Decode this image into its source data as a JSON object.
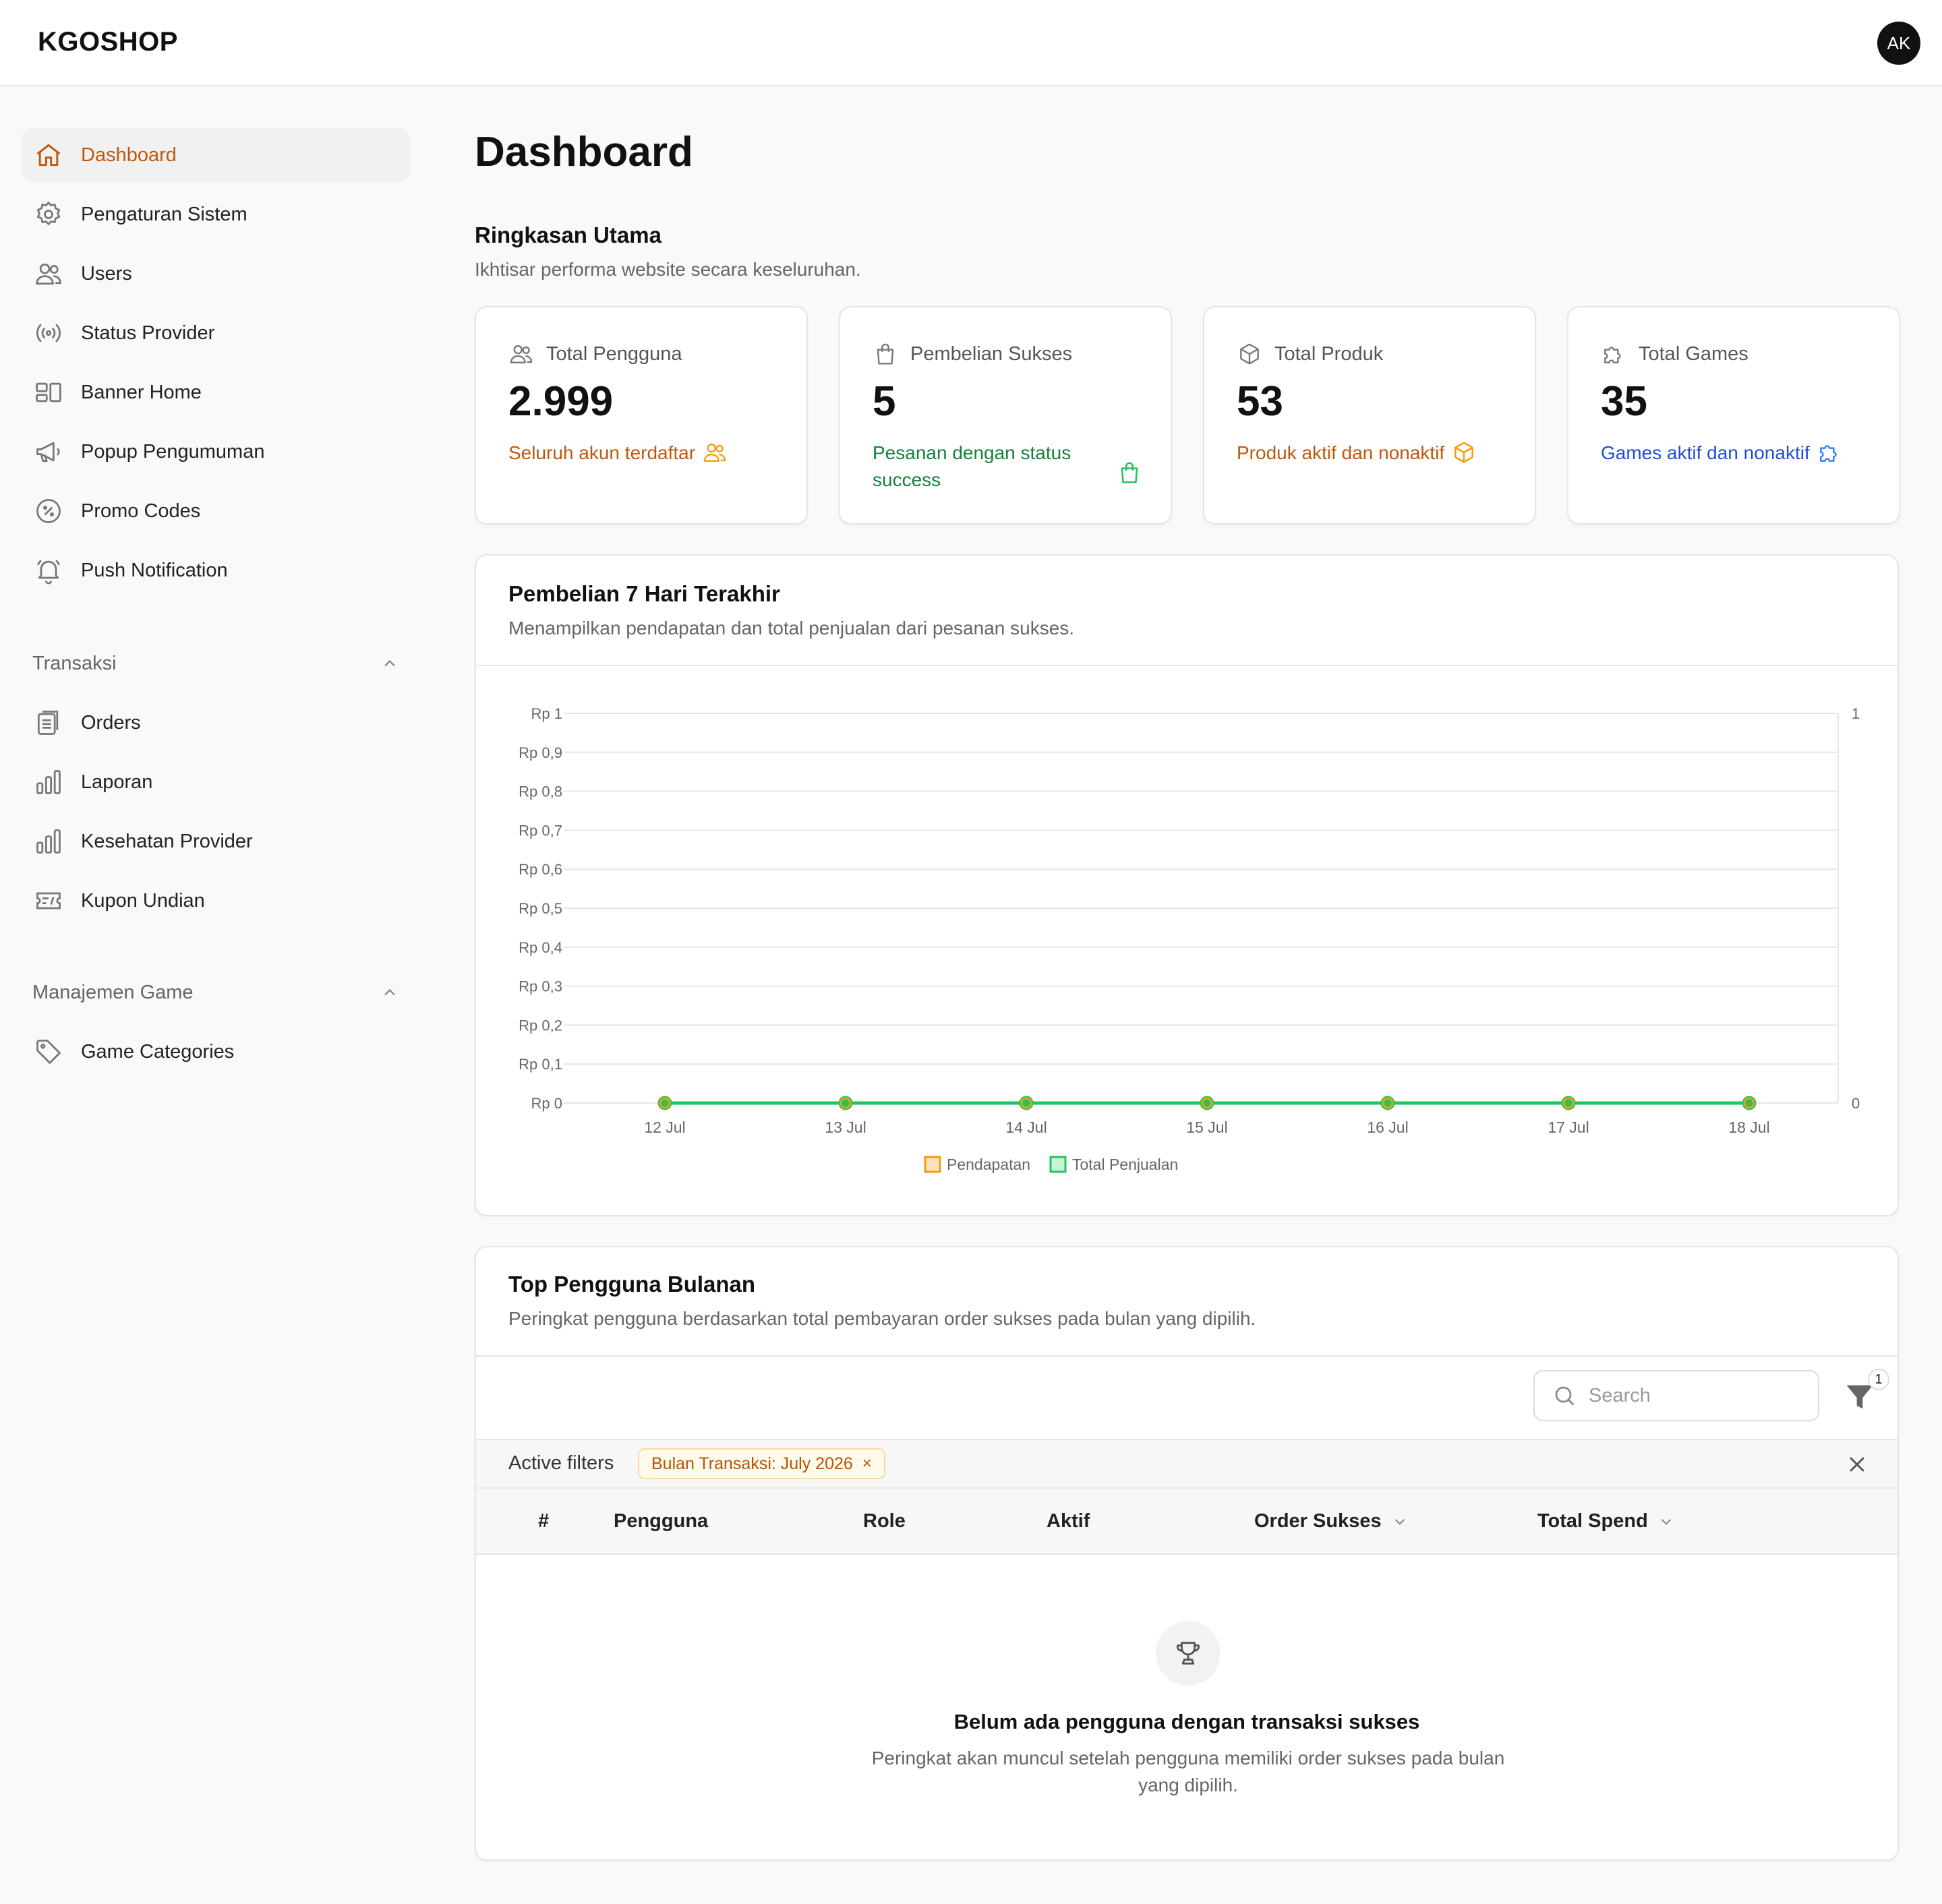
{
  "app": {
    "logo": "KGOSHOP",
    "avatar_initials": "AK"
  },
  "sidebar": {
    "items": [
      {
        "label": "Dashboard",
        "icon": "home-icon",
        "active": true
      },
      {
        "label": "Pengaturan Sistem",
        "icon": "gear-icon"
      },
      {
        "label": "Users",
        "icon": "users-icon"
      },
      {
        "label": "Status Provider",
        "icon": "broadcast-icon"
      },
      {
        "label": "Banner Home",
        "icon": "layout-icon"
      },
      {
        "label": "Popup Pengumuman",
        "icon": "megaphone-icon"
      },
      {
        "label": "Promo Codes",
        "icon": "percent-badge-icon"
      },
      {
        "label": "Push Notification",
        "icon": "bell-icon"
      }
    ],
    "sections": [
      {
        "title": "Transaksi",
        "items": [
          {
            "label": "Orders",
            "icon": "clipboard-list-icon"
          },
          {
            "label": "Laporan",
            "icon": "bar-chart-icon"
          },
          {
            "label": "Kesehatan Provider",
            "icon": "bar-chart-icon"
          },
          {
            "label": "Kupon Undian",
            "icon": "ticket-icon"
          }
        ]
      },
      {
        "title": "Manajemen Game",
        "items": [
          {
            "label": "Game Categories",
            "icon": "tag-icon"
          }
        ]
      }
    ]
  },
  "page": {
    "title": "Dashboard",
    "summary_title": "Ringkasan Utama",
    "summary_sub": "Ikhtisar performa website secara keseluruhan."
  },
  "stats": [
    {
      "label": "Total Pengguna",
      "value": "2.999",
      "desc": "Seluruh akun terdaftar",
      "color": "#c2570c",
      "icon_color": "#f59e0b",
      "icon": "users-icon"
    },
    {
      "label": "Pembelian Sukses",
      "value": "5",
      "desc": "Pesanan dengan status success",
      "color": "#15803d",
      "icon_color": "#22c55e",
      "icon": "shopping-bag-icon"
    },
    {
      "label": "Total Produk",
      "value": "53",
      "desc": "Produk aktif dan nonaktif",
      "color": "#c2570c",
      "icon_color": "#f59e0b",
      "icon": "box-icon"
    },
    {
      "label": "Total Games",
      "value": "35",
      "desc": "Games aktif dan nonaktif",
      "color": "#1d4ed8",
      "icon_color": "#3b82f6",
      "icon": "puzzle-icon"
    }
  ],
  "chart": {
    "title": "Pembelian 7 Hari Terakhir",
    "subtitle": "Menampilkan pendapatan dan total penjualan dari pesanan sukses."
  },
  "chart_data": {
    "type": "line",
    "x": [
      "12 Jul",
      "13 Jul",
      "14 Jul",
      "15 Jul",
      "16 Jul",
      "17 Jul",
      "18 Jul"
    ],
    "series": [
      {
        "name": "Pendapatan",
        "values": [
          0,
          0,
          0,
          0,
          0,
          0,
          0
        ],
        "color": "#f59e0b",
        "axis": "left"
      },
      {
        "name": "Total Penjualan",
        "values": [
          0,
          0,
          0,
          0,
          0,
          0,
          0
        ],
        "color": "#22c55e",
        "axis": "right"
      }
    ],
    "y_left": {
      "ticks": [
        "Rp 0",
        "Rp 0,1",
        "Rp 0,2",
        "Rp 0,3",
        "Rp 0,4",
        "Rp 0,5",
        "Rp 0,6",
        "Rp 0,7",
        "Rp 0,8",
        "Rp 0,9",
        "Rp 1"
      ],
      "ylim": [
        0,
        1
      ]
    },
    "y_right": {
      "ticks": [
        "0",
        "1"
      ],
      "ylim": [
        0,
        1
      ]
    },
    "grid": true,
    "legend_position": "bottom-center"
  },
  "top_users": {
    "title": "Top Pengguna Bulanan",
    "subtitle": "Peringkat pengguna berdasarkan total pembayaran order sukses pada bulan yang dipilih.",
    "search_placeholder": "Search",
    "filter_count": "1",
    "active_filters_label": "Active filters",
    "filter_chip": "Bulan Transaksi: July 2026",
    "filter_chip_close": "×",
    "columns": [
      "#",
      "Pengguna",
      "Role",
      "Aktif",
      "Order Sukses",
      "Total Spend"
    ],
    "empty_title": "Belum ada pengguna dengan transaksi sukses",
    "empty_sub": "Peringkat akan muncul setelah pengguna memiliki order sukses pada bulan yang dipilih."
  }
}
